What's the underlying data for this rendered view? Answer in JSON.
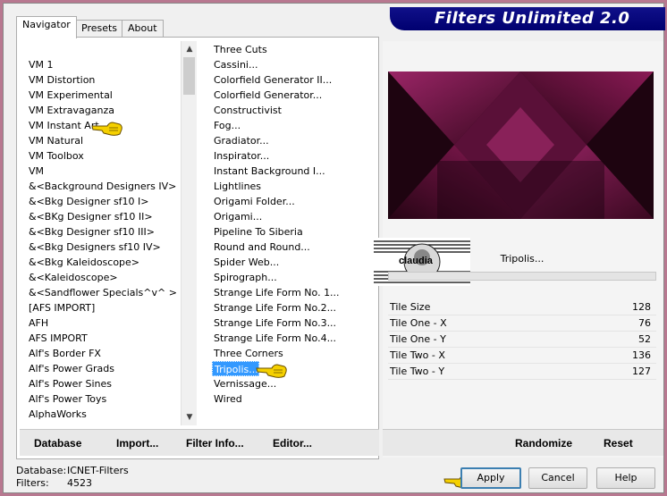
{
  "app_title": "Filters Unlimited 2.0",
  "tabs": [
    {
      "label": "Navigator",
      "active": true
    },
    {
      "label": "Presets",
      "active": false
    },
    {
      "label": "About",
      "active": false
    }
  ],
  "categories": [
    "VM 1",
    "VM Distortion",
    "VM Experimental",
    "VM Extravaganza",
    "VM Instant Art",
    "VM Natural",
    "VM Toolbox",
    "VM",
    "&<Background Designers IV>",
    "&<Bkg Designer sf10 I>",
    "&<BKg Designer sf10 II>",
    "&<Bkg Designer sf10 III>",
    "&<Bkg Designers sf10 IV>",
    "&<Bkg Kaleidoscope>",
    "&<Kaleidoscope>",
    "&<Sandflower Specials^v^ >",
    "[AFS IMPORT]",
    "AFH",
    "AFS IMPORT",
    "Alf's Border FX",
    "Alf's Power Grads",
    "Alf's Power Sines",
    "Alf's Power Toys",
    "AlphaWorks"
  ],
  "selected_category": "VM Instant Art",
  "filters": [
    "Three Cuts",
    "Cassini...",
    "Colorfield Generator II...",
    "Colorfield Generator...",
    "Constructivist",
    "Fog...",
    "Gradiator...",
    "Inspirator...",
    "Instant Background I...",
    "Lightlines",
    "Origami Folder...",
    "Origami...",
    "Pipeline To Siberia",
    "Round and Round...",
    "Spider Web...",
    "Spirograph...",
    "Strange Life Form No. 1...",
    "Strange Life Form No.2...",
    "Strange Life Form No.3...",
    "Strange Life Form No.4...",
    "Three Corners",
    "Tripolis...",
    "Vernissage...",
    "Wired"
  ],
  "selected_filter": "Tripolis...",
  "left_buttons": {
    "database": "Database",
    "import": "Import...",
    "filter_info": "Filter Info...",
    "editor": "Editor..."
  },
  "watermark_text": "claudia",
  "filter_name": "Tripolis...",
  "params": [
    {
      "label": "Tile Size",
      "value": "128"
    },
    {
      "label": "Tile One - X",
      "value": "76"
    },
    {
      "label": "Tile One - Y",
      "value": "52"
    },
    {
      "label": "Tile Two - X",
      "value": "136"
    },
    {
      "label": "Tile Two - Y",
      "value": "127"
    }
  ],
  "right_buttons": {
    "randomize": "Randomize",
    "reset": "Reset"
  },
  "status": {
    "database_label": "Database:",
    "database_value": "ICNET-Filters",
    "filters_label": "Filters:",
    "filters_value": "4523"
  },
  "dialog_buttons": {
    "apply": "Apply",
    "cancel": "Cancel",
    "help": "Help"
  },
  "colors": {
    "accent_blue": "#000070",
    "selection": "#3399ff",
    "preview_dark": "#3a0a24",
    "preview_magenta": "#8a1a55"
  }
}
